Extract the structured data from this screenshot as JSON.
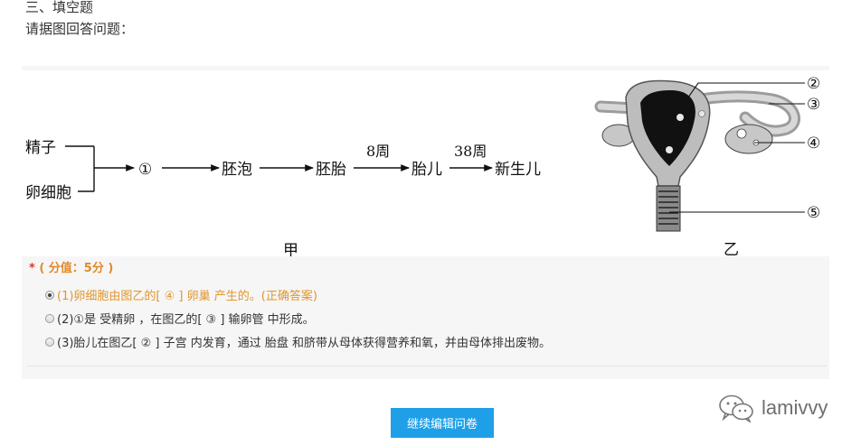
{
  "section_title": "三、填空题",
  "question_prompt": "请据图回答问题：",
  "figure_left": {
    "input_1": "精子",
    "input_2": "卵细胞",
    "stage_1": "①",
    "stage_2": "胚泡",
    "stage_3": "胚胎",
    "week_label_1": "8周",
    "stage_4": "胎儿",
    "week_label_2": "38周",
    "stage_5": "新生儿",
    "caption": "甲"
  },
  "figure_right": {
    "labels": [
      "②",
      "③",
      "④",
      "⑤"
    ],
    "caption": "乙"
  },
  "score": {
    "star": "*",
    "text": "( 分值：5分 )"
  },
  "answers": [
    {
      "text": "(1)卵细胞由图乙的[ ④ ] 卵巢 产生的。(正确答案)",
      "checked": true
    },
    {
      "text": "(2)①是 受精卵 ，在图乙的[ ③ ] 输卵管 中形成。",
      "checked": false
    },
    {
      "text": "(3)胎儿在图乙[ ② ] 子宫 内发育，通过 胎盘 和脐带从母体获得营养和氧，并由母体排出废物。",
      "checked": false
    }
  ],
  "continue_button_label": "继续编辑问卷",
  "watermark": {
    "icon": "wechat-icon",
    "text": "lamivvy"
  },
  "colors": {
    "accent_orange": "#e08a28",
    "required_red": "#e0362d",
    "button_blue": "#1e9fe8"
  }
}
